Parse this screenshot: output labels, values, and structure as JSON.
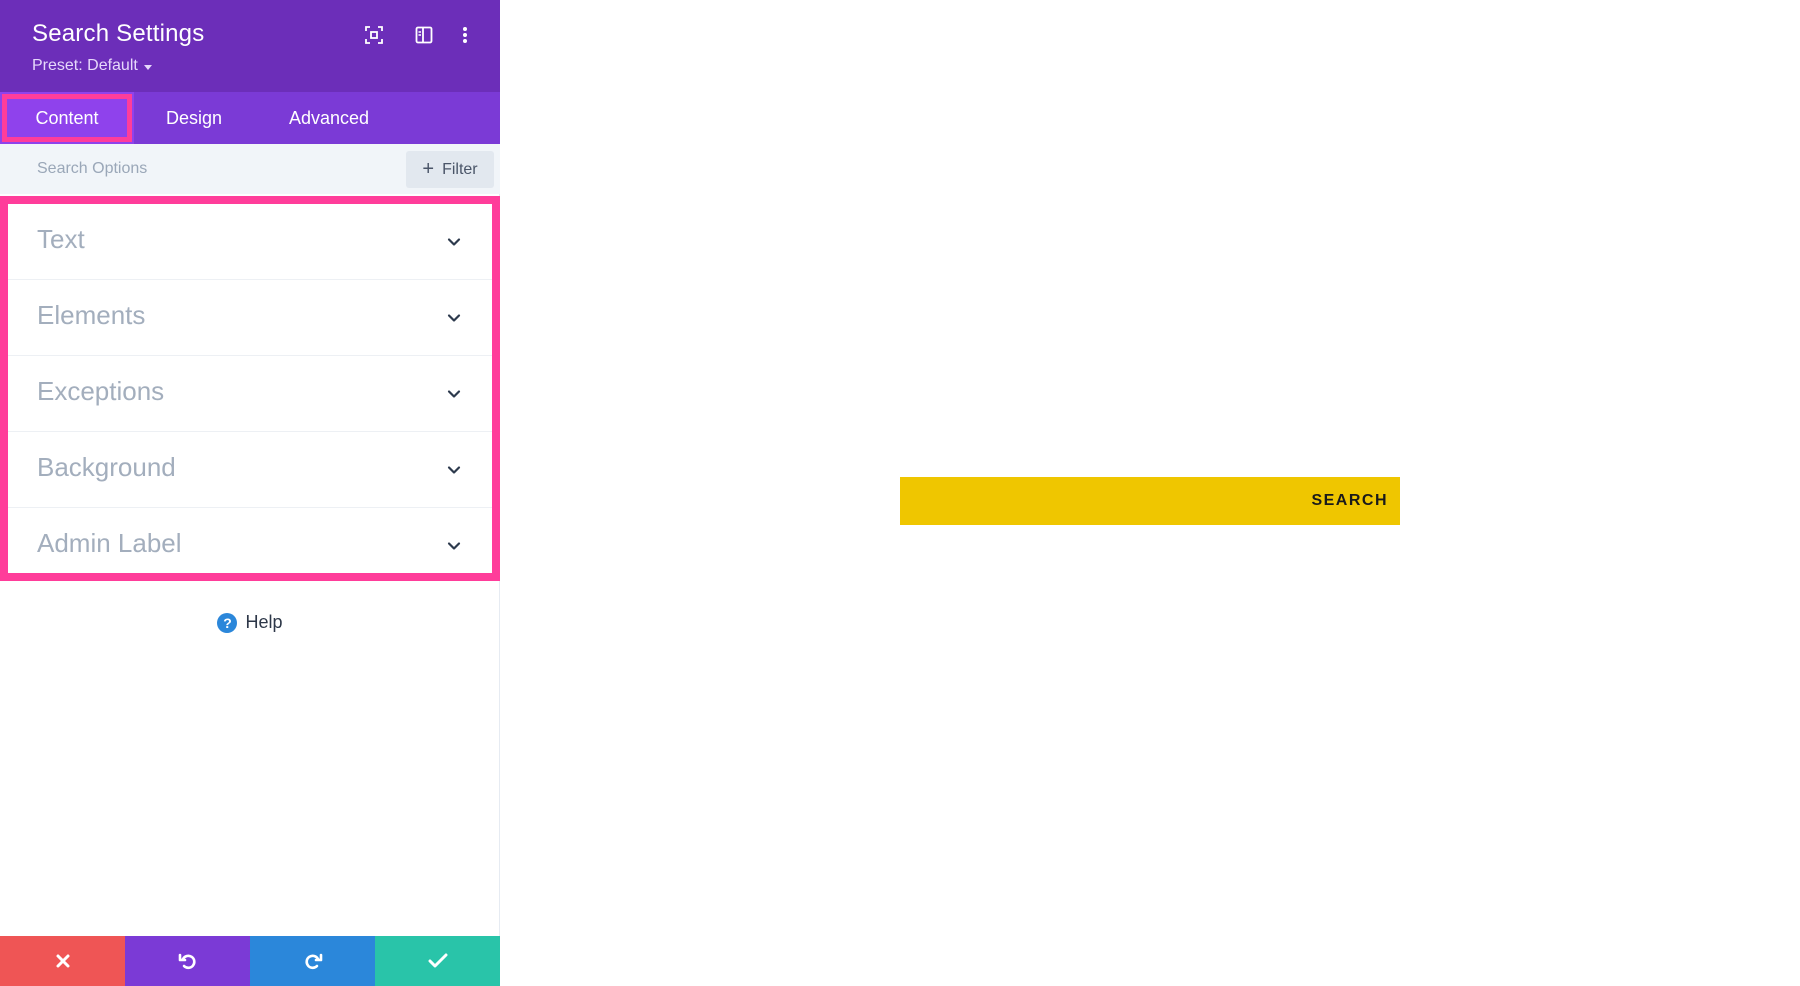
{
  "panel": {
    "title": "Search Settings",
    "preset": "Preset: Default",
    "header_icons": [
      "expand-icon",
      "sidebar-layout-icon",
      "more-vertical-icon"
    ]
  },
  "tabs": [
    {
      "label": "Content",
      "active": true
    },
    {
      "label": "Design",
      "active": false
    },
    {
      "label": "Advanced",
      "active": false
    }
  ],
  "search": {
    "placeholder": "Search Options",
    "filter_label": "Filter"
  },
  "sections": [
    {
      "label": "Text"
    },
    {
      "label": "Elements"
    },
    {
      "label": "Exceptions"
    },
    {
      "label": "Background"
    },
    {
      "label": "Admin Label"
    }
  ],
  "help": {
    "label": "Help"
  },
  "footer": {
    "buttons": [
      {
        "name": "cancel",
        "icon": "close-icon",
        "color": "#ef5555"
      },
      {
        "name": "undo",
        "icon": "undo-icon",
        "color": "#7b3ad6"
      },
      {
        "name": "redo",
        "icon": "redo-icon",
        "color": "#2b87da"
      },
      {
        "name": "save",
        "icon": "check-icon",
        "color": "#29c4a9"
      }
    ]
  },
  "canvas": {
    "search_button_label": "SEARCH"
  },
  "colors": {
    "header_bg": "#6c2eb9",
    "tabs_bg": "#7b3ad6",
    "active_tab_bg": "#8f42ec",
    "highlight": "#ff3d9a",
    "search_module_bg": "#efc600"
  }
}
